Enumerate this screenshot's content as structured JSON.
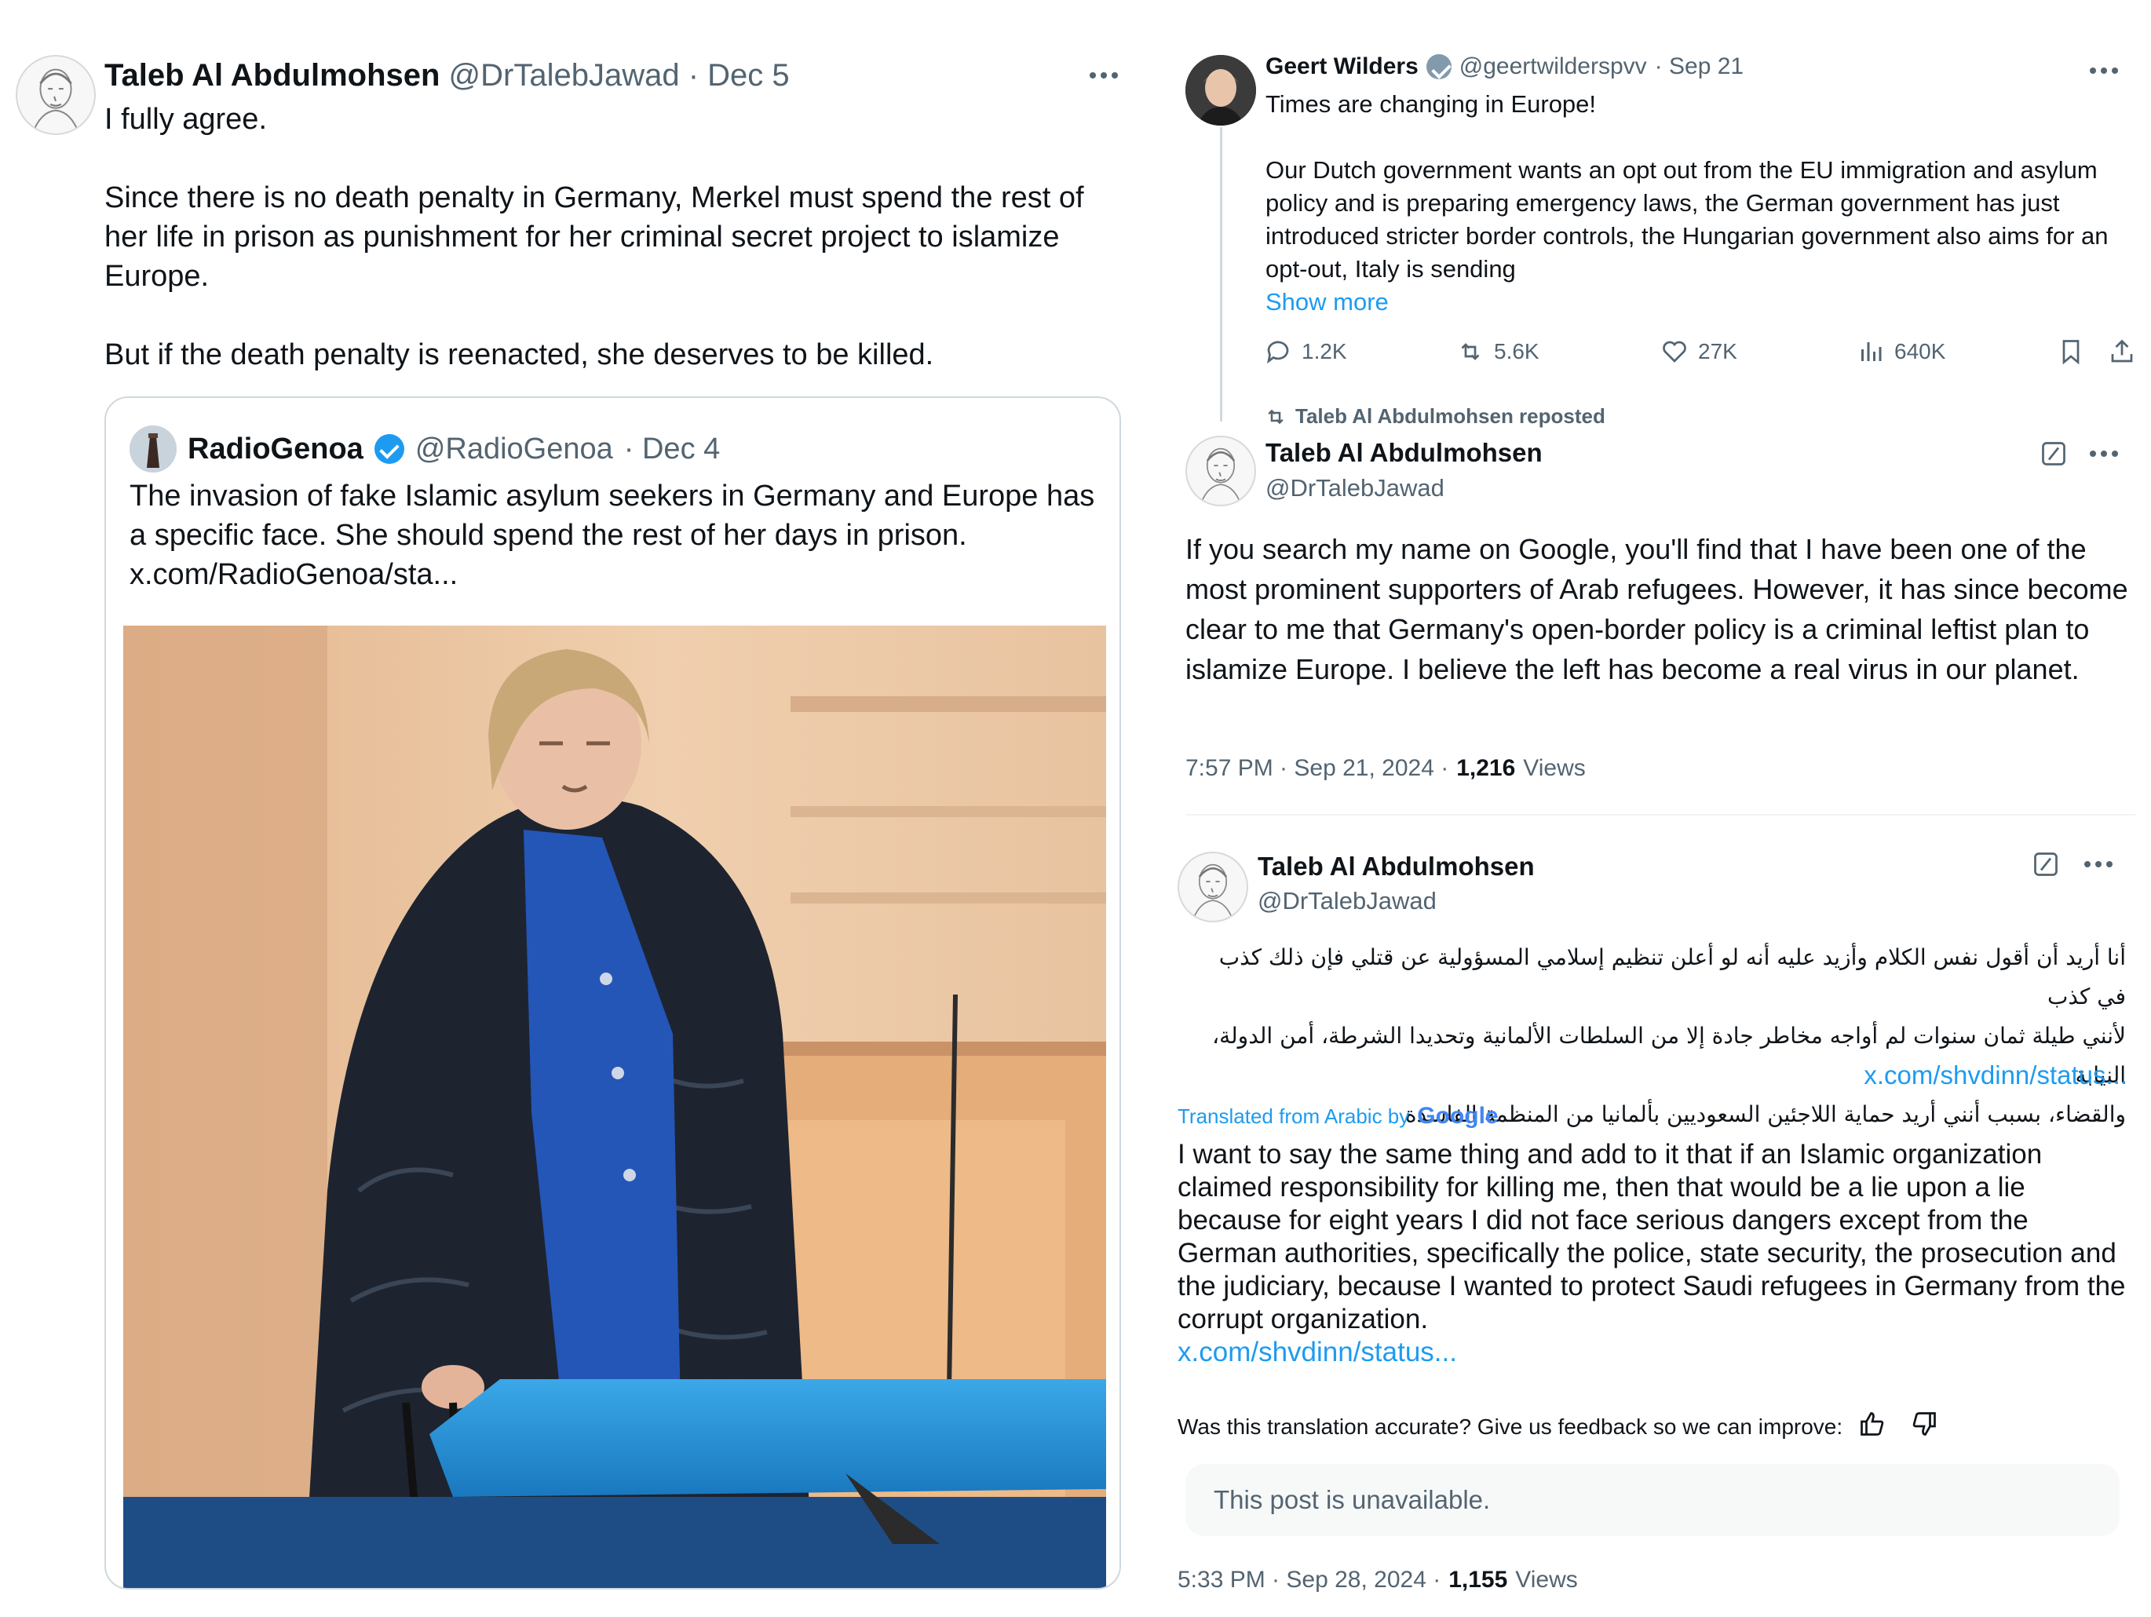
{
  "left_post": {
    "author_name": "Taleb Al Abdulmohsen",
    "author_handle": "@DrTalebJawad",
    "date": "· Dec 5",
    "paragraphs": [
      "I fully agree.",
      "Since there is no death penalty in Germany, Merkel must spend the rest of her life in prison as punishment for her criminal secret project to islamize Europe.",
      "But if the death penalty is reenacted, she deserves to be killed."
    ],
    "quote": {
      "author_name": "RadioGenoa",
      "author_handle": "@RadioGenoa",
      "date": "· Dec 4",
      "text": "The invasion of fake Islamic asylum seekers in Germany and Europe has a specific face. She should spend the rest of her days in prison.",
      "link": "x.com/RadioGenoa/sta..."
    }
  },
  "right_post_1": {
    "author_name": "Geert Wilders",
    "author_handle": "@geertwilderspvv",
    "date": "· Sep 21",
    "line1": "Times are changing in Europe!",
    "body": "Our Dutch government wants an opt out from the EU immigration and asylum policy and is preparing emergency laws, the German government has just introduced stricter border controls, the Hungarian government also aims for an opt-out, Italy is sending",
    "show_more": "Show more",
    "stats": {
      "replies": "1.2K",
      "reposts": "5.6K",
      "likes": "27K",
      "views": "640K"
    }
  },
  "right_post_2": {
    "repost_label": "Taleb Al Abdulmohsen reposted",
    "author_name": "Taleb Al Abdulmohsen",
    "author_handle": "@DrTalebJawad",
    "text": "If you search my name on Google, you'll find that I have been one of the most prominent supporters of Arab refugees. However, it has since become clear to me that Germany's open-border policy is a criminal leftist plan to islamize Europe. I believe the left has become a real virus in our planet.",
    "timestamp": "7:57 PM · Sep 21, 2024 ·",
    "views_count": "1,216",
    "views_label": "Views"
  },
  "right_post_3": {
    "author_name": "Taleb Al Abdulmohsen",
    "author_handle": "@DrTalebJawad",
    "arabic_lines": [
      "أنا أريد أن أقول نفس الكلام وأزيد عليه أنه لو أعلن تنظيم إسلامي المسؤولية عن قتلي فإن ذلك كذب في كذب",
      "لأنني طيلة ثمان سنوات لم أواجه مخاطر جادة إلا من السلطات الألمانية وتحديدا الشرطة، أمن الدولة، النيابة",
      "والقضاء، بسبب أنني أريد حماية اللاجئين السعوديين بألمانيا من المنظمة الفاسدة"
    ],
    "arabic_link": "x.com/shvdinn/status...",
    "translated_label": "Translated from Arabic by",
    "translator": "Google",
    "translation": "I want to say the same thing and add to it that if an Islamic organization claimed responsibility for killing me, then that would be a lie upon a lie because for eight years I did not face serious dangers except from the German authorities, specifically the police, state security, the prosecution and the judiciary, because I wanted to protect Saudi refugees in Germany from the corrupt organization.",
    "translation_link": "x.com/shvdinn/status...",
    "feedback": "Was this translation accurate? Give us feedback so we can improve:",
    "unavailable": "This post is unavailable.",
    "timestamp": "5:33 PM · Sep 28, 2024 ·",
    "views_count": "1,155",
    "views_label": "Views"
  },
  "colors": {
    "link_blue": "#1d9bf0",
    "secondary_gray": "#536471",
    "border": "#cfd9de",
    "verified_blue": "#1d9bf0",
    "verified_gray": "#829aab"
  }
}
